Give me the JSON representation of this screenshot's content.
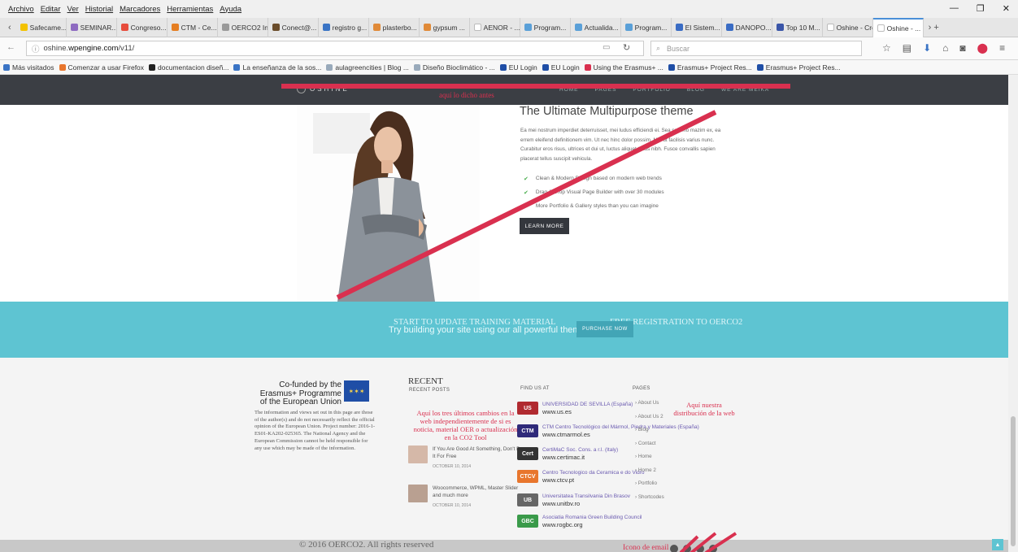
{
  "menu": [
    "Archivo",
    "Editar",
    "Ver",
    "Historial",
    "Marcadores",
    "Herramientas",
    "Ayuda"
  ],
  "tabs": [
    {
      "label": "Safecame...",
      "color": "#f3c200"
    },
    {
      "label": "SEMINAR...",
      "color": "#8e6bc1"
    },
    {
      "label": "Congreso...",
      "color": "#e74c3c"
    },
    {
      "label": "CTM - Ce...",
      "color": "#e57e22"
    },
    {
      "label": "OERCO2 Inter...",
      "color": "#9a9a9a"
    },
    {
      "label": "Conect@...",
      "color": "#6a4c2a"
    },
    {
      "label": "registro g...",
      "color": "#3a74c5"
    },
    {
      "label": "plasterbo...",
      "color": "#e08a38"
    },
    {
      "label": "gypsum ...",
      "color": "#e08a38"
    },
    {
      "label": "AENOR - ...",
      "color": "#ffffff"
    },
    {
      "label": "Program...",
      "color": "#5aa0d8"
    },
    {
      "label": "Actualida...",
      "color": "#5aa0d8"
    },
    {
      "label": "Program...",
      "color": "#5aa0d8"
    },
    {
      "label": "El Sistem...",
      "color": "#3a6cc4"
    },
    {
      "label": "DANOPO...",
      "color": "#3a6cc4"
    },
    {
      "label": "Top 10 M...",
      "color": "#3a55a8"
    },
    {
      "label": "Oshine - Crea...",
      "color": "#ffffff"
    },
    {
      "label": "Oshine - ...",
      "color": "#ffffff"
    }
  ],
  "url": {
    "prefix": "oshine.",
    "domain": "wpengine.com",
    "path": "/v11/"
  },
  "search_placeholder": "Buscar",
  "bookmarks": [
    {
      "label": "Más visitados",
      "color": "#3a74c5"
    },
    {
      "label": "Comenzar a usar Firefox",
      "color": "#e8762d"
    },
    {
      "label": "documentacion diseñ...",
      "color": "#222222"
    },
    {
      "label": "La enseñanza de la sos...",
      "color": "#3a74c5"
    },
    {
      "label": "aulagreencities | Blog ...",
      "color": "#9ab"
    },
    {
      "label": "Diseño Bioclimático - ...",
      "color": "#9ab"
    },
    {
      "label": "EU Login",
      "color": "#1f4ea6"
    },
    {
      "label": "EU Login",
      "color": "#1f4ea6"
    },
    {
      "label": "Using the Erasmus+ ...",
      "color": "#d9304f"
    },
    {
      "label": "Erasmus+ Project Res...",
      "color": "#1f4ea6"
    },
    {
      "label": "Erasmus+ Project Res...",
      "color": "#1f4ea6"
    }
  ],
  "site": {
    "logo": "OSHINE",
    "nav": [
      "HOME",
      "PAGES",
      "PORTFOLIO",
      "BLOG",
      "WE ARE MEIKA"
    ],
    "header_note": "aquí lo dicho antes",
    "hero_title": "The Ultimate Multipurpose theme",
    "hero_body": "Ea mei nostrum imperdiet deterruisset, mei ludus efficiendi ei. Sea summo mazim ex, ea errem eleifend definitionem vim. Ut nec hinc dolor possim. Mei ut facilisis varius nunc. Curabitur eros risus, ultrices et dui ut, luctus aliquet tellus nibh. Fusce convallis sapien placerat tellus suscipit vehicula.",
    "features": [
      "Clean & Modern Design based on modern web trends",
      "Drag & Drop Visual Page Builder with over 30 modules",
      "More Portfolio & Gallery styles than you can imagine"
    ],
    "learn_more": "LEARN MORE",
    "banner_text": "Try building your site using our all powerful theme",
    "banner_overlay_1": "START TO UPDATE TRAINING MATERIAL",
    "banner_overlay_2": "FREE REGISTRATION TO OERCO2",
    "purchase": "PURCHASE NOW",
    "cofunded": "Co-funded by the Erasmus+ Programme of the European Union",
    "disclaimer": "The information and views set out in this page are those of the author(s) and do not necessarily reflect the official opinion of the European Union. Project number: 2016-1-ES01-KA202-025365. The National Agency and the European Commission cannot be held responsible for any use which may be made of the information.",
    "recent_title": "RECENT",
    "recent_posts_label": "RECENT POSTS",
    "recent_note": "Aquí los tres últimos cambios en la web independientemente de si es noticia, material OER o actualización en la CO2 Tool",
    "posts": [
      {
        "title": "If You Are Good At Something, Don't Do It For Free",
        "date": "OCTOBER 10, 2014"
      },
      {
        "title": "Woocommerce, WPML, Master Slider and much more",
        "date": "OCTOBER 10, 2014"
      }
    ],
    "find_us": "FIND US AT",
    "pages_title": "PAGES",
    "pages_note": "Aquí nuestra distribución de la web",
    "partners": [
      {
        "name": "UNIVERSIDAD DE SEVILLA (España)",
        "url": "www.us.es",
        "color": "#b02a30",
        "logo": "US"
      },
      {
        "name": "CTM Centro Tecnológico del Mármol, Piedra y Materiales (España)",
        "url": "www.ctmarmol.es",
        "color": "#2f2a7a",
        "logo": "CTM"
      },
      {
        "name": "CertiMaC Soc. Cons. a r.l. (Italy)",
        "url": "www.certimac.it",
        "color": "#333333",
        "logo": "Cert"
      },
      {
        "name": "Centro Tecnologico da Ceramica e do Vidro",
        "url": "www.ctcv.pt",
        "color": "#e8762d",
        "logo": "CTCV"
      },
      {
        "name": "Universitatea Transilvania Din Brasov",
        "url": "www.unitbv.ro",
        "color": "#666666",
        "logo": "UB"
      },
      {
        "name": "Asociatia Romania Green Building Council",
        "url": "www.rogbc.org",
        "color": "#3a9a4a",
        "logo": "GBC"
      }
    ],
    "pages": [
      "About Us",
      "About Us 2",
      "Blog",
      "Contact",
      "Home",
      "Home 2",
      "Portfolio",
      "Shortcodes"
    ],
    "copyright": "© 2016 OERCO2. All rights reserved",
    "icono_note": "Icono de email"
  }
}
